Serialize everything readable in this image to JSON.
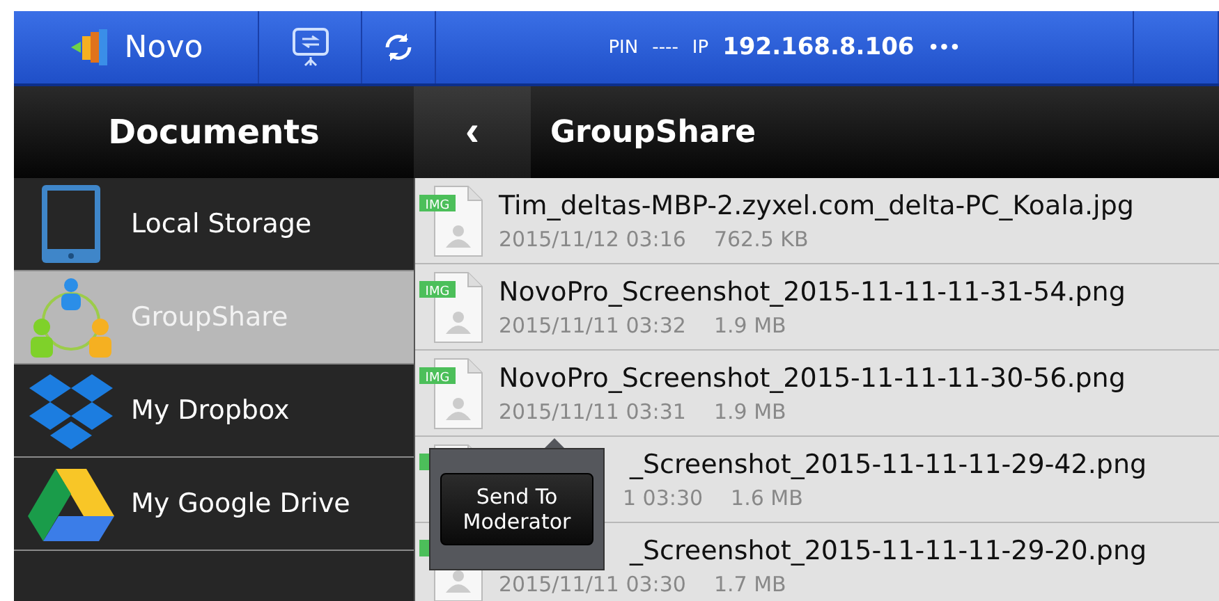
{
  "top_bar": {
    "app_name": "Novo",
    "pin_label": "PIN",
    "pin": "----",
    "ip_label": "IP",
    "ip": "192.168.8.106",
    "more": "•••"
  },
  "sidebar": {
    "title": "Documents",
    "items": [
      {
        "label": "Local Storage",
        "kind": "tablet",
        "selected": false
      },
      {
        "label": "GroupShare",
        "kind": "group",
        "selected": true
      },
      {
        "label": "My Dropbox",
        "kind": "dropbox",
        "selected": false
      },
      {
        "label": "My Google Drive",
        "kind": "drive",
        "selected": false
      }
    ]
  },
  "content": {
    "back": "‹",
    "title": "GroupShare",
    "files": [
      {
        "kind": "plain",
        "tag": "IMG",
        "name": "Tim_deltas-MBP-2.zyxel.com_delta-PC_Koala.jpg",
        "date": "2015/11/12 03:16",
        "size": "762.5 KB"
      },
      {
        "kind": "plain",
        "tag": "IMG",
        "name": "NovoPro_Screenshot_2015-11-11-11-31-54.png",
        "date": "2015/11/11 03:32",
        "size": "1.9 MB"
      },
      {
        "kind": "plain",
        "tag": "IMG",
        "name": "NovoPro_Screenshot_2015-11-11-11-30-56.png",
        "date": "2015/11/11 03:31",
        "size": "1.9 MB"
      },
      {
        "kind": "covered-both",
        "name": "_Screenshot_2015-11-11-11-29-42.png",
        "date": "1 03:30",
        "size": "1.6 MB"
      },
      {
        "kind": "covered-name",
        "name": "_Screenshot_2015-11-11-11-29-20.png",
        "date": "2015/11/11 03:30",
        "size": "1.7 MB"
      }
    ],
    "popup": {
      "label": "Send To Moderator"
    }
  }
}
